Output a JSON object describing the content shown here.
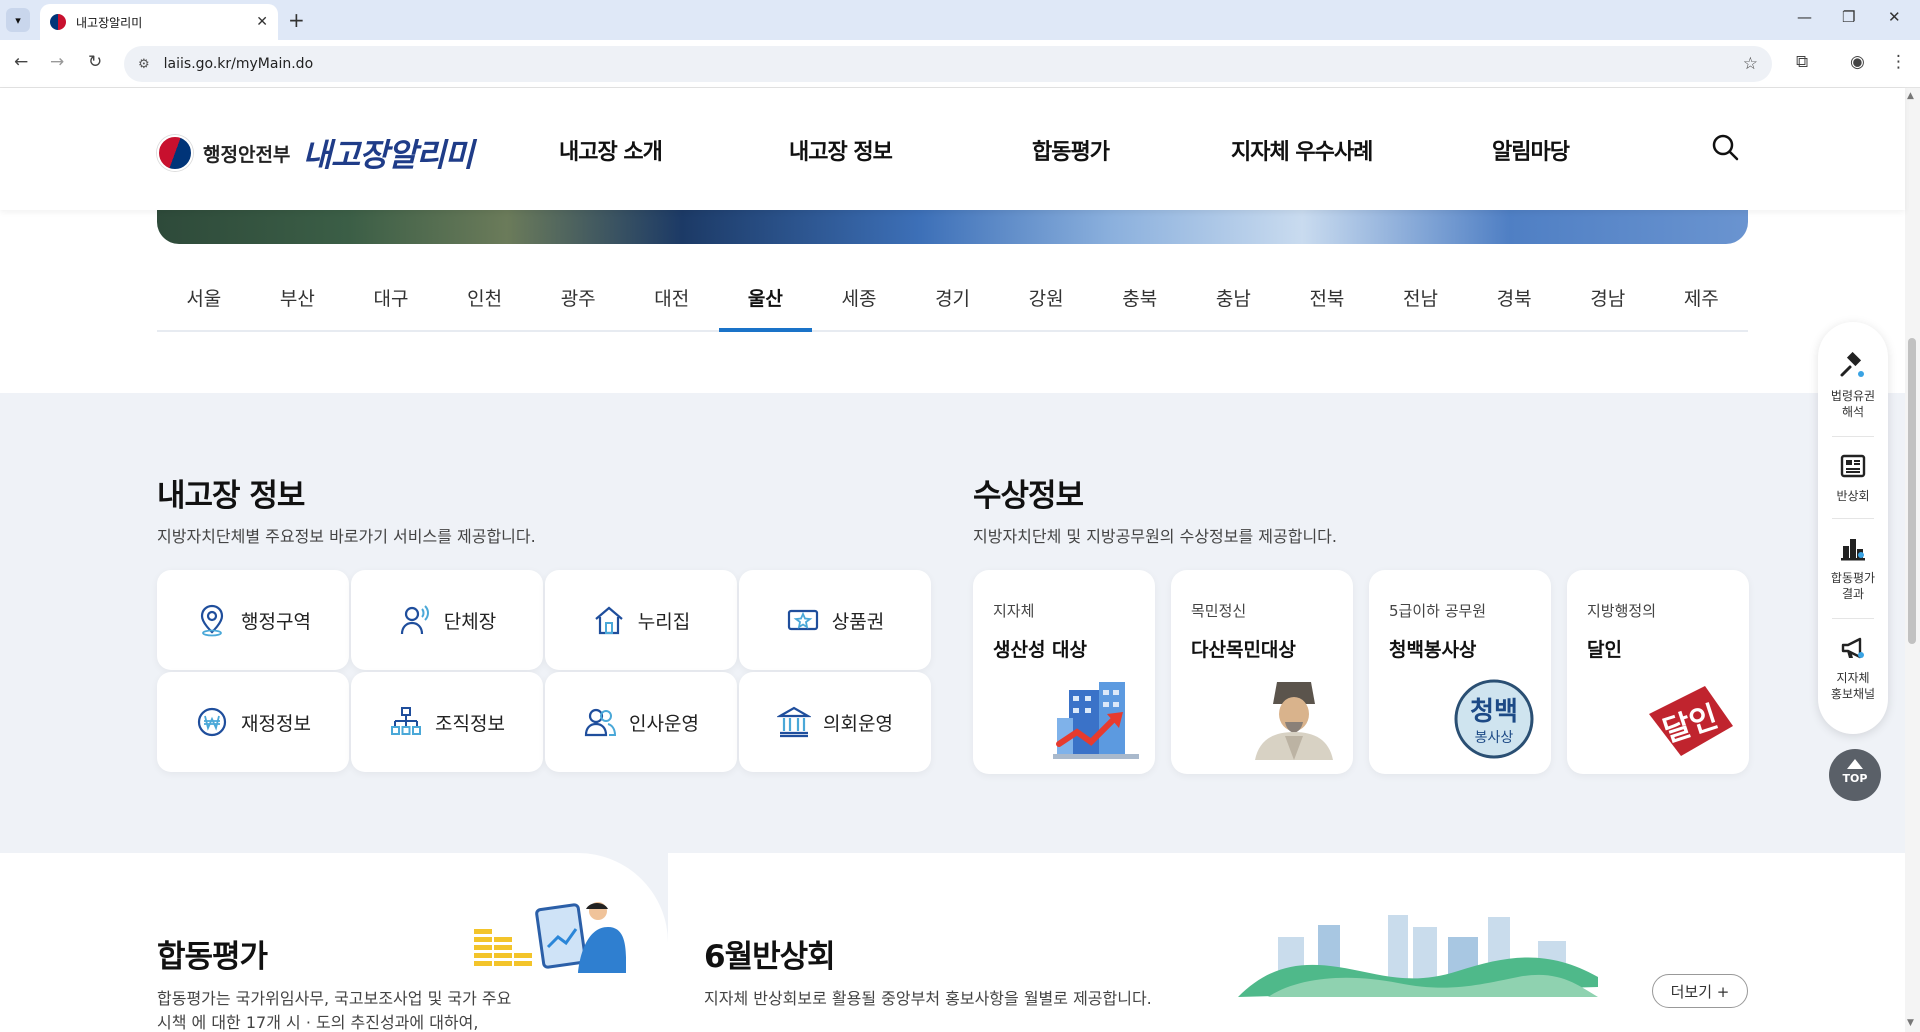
{
  "browser": {
    "tab_title": "내고장알리미",
    "url": "laiis.go.kr/myMain.do"
  },
  "header": {
    "ministry": "행정안전부",
    "brand": "내고장알리미",
    "nav": [
      "내고장 소개",
      "내고장 정보",
      "합동평가",
      "지자체 우수사례",
      "알림마당"
    ]
  },
  "regions": {
    "items": [
      "서울",
      "부산",
      "대구",
      "인천",
      "광주",
      "대전",
      "울산",
      "세종",
      "경기",
      "강원",
      "충북",
      "충남",
      "전북",
      "전남",
      "경북",
      "경남",
      "제주"
    ],
    "active": "울산"
  },
  "info": {
    "title": "내고장 정보",
    "desc": "지방자치단체별 주요정보 바로가기 서비스를 제공합니다.",
    "items": [
      "행정구역",
      "단체장",
      "누리집",
      "상품권",
      "재정정보",
      "조직정보",
      "인사운영",
      "의회운영"
    ]
  },
  "awards": {
    "title": "수상정보",
    "desc": "지방자치단체 및 지방공무원의 수상정보를 제공합니다.",
    "items": [
      {
        "sub": "지자체",
        "main": "생산성 대상"
      },
      {
        "sub": "목민정신",
        "main": "다산목민대상"
      },
      {
        "sub": "5급이하 공무원",
        "main": "청백봉사상",
        "art_text_1": "청백",
        "art_text_2": "봉사상"
      },
      {
        "sub": "지방행정의",
        "main": "달인",
        "art_text": "달인"
      }
    ]
  },
  "quick": {
    "items": [
      {
        "label_1": "법령유권",
        "label_2": "해석"
      },
      {
        "label_1": "반상회",
        "label_2": ""
      },
      {
        "label_1": "합동평가",
        "label_2": "결과"
      },
      {
        "label_1": "지자체",
        "label_2": "홍보채널"
      }
    ],
    "top": "TOP"
  },
  "joint_eval": {
    "title": "합동평가",
    "desc_1": "합동평가는 국가위임사무, 국고보조사업 및 국가 주요",
    "desc_2": "시책 에 대한 17개 시 · 도의 추진성과에 대하여,"
  },
  "meeting": {
    "title": "6월반상회",
    "desc": "지자체 반상회보로 활용될 중앙부처 홍보사항을 월별로 제공합니다.",
    "more": "더보기 +"
  }
}
